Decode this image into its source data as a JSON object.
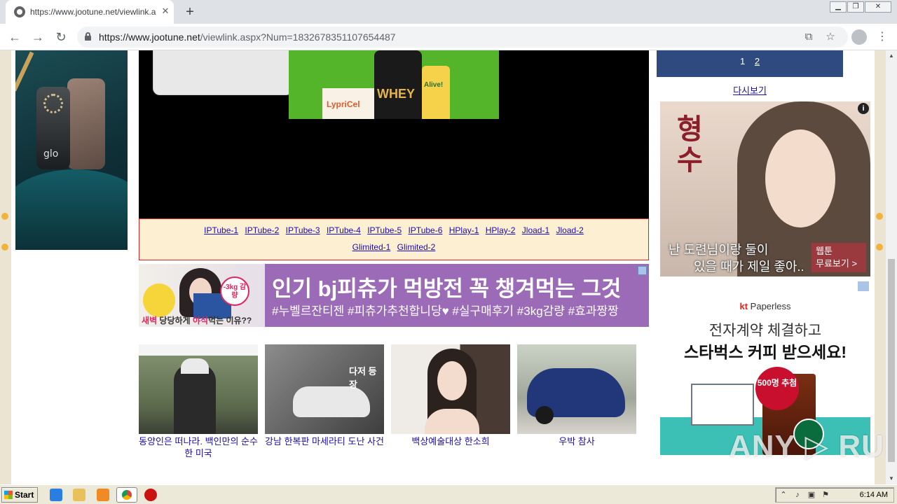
{
  "browser": {
    "tab_title": "https://www.jootune.net/viewlink.a",
    "url_host": "https://www.jootune.net",
    "url_path": "/viewlink.aspx?Num=1832678351107654487",
    "new_tab_symbol": "+",
    "close_symbol": "✕"
  },
  "left_ad": {
    "brand": "glo"
  },
  "player_banner": {
    "tub_label": "WHEY",
    "bottle_label": "Alive!",
    "box_label": "LypriCel"
  },
  "link_bar": {
    "row1": [
      "IPTube-1",
      "IPTube-2",
      "IPTube-3",
      "IPTube-4",
      "IPTube-5",
      "IPTube-6",
      "HPlay-1",
      "HPlay-2",
      "Jload-1",
      "Jload-2"
    ],
    "row2": [
      "Glimited-1",
      "Glimited-2"
    ]
  },
  "promo": {
    "headline": "인기 bj피츄가 먹방전 꼭 챙겨먹는 그것",
    "tags": "#누벨르잔티젠 #피츄가추천합니당♥ #실구매후기 #3kg감량 #효과짱짱",
    "badge": "-3kg 감량",
    "caption_red1": "새벽",
    "caption_mid": " 당당하게 ",
    "caption_red2": "야식",
    "caption_end": "먹는 이유??"
  },
  "thumbnails": [
    {
      "caption": "동양인은 떠나라. 백인만의 순수한 미국"
    },
    {
      "caption": "강남 한복판 마세라티 도난 사건",
      "overlay": "다저 등장"
    },
    {
      "caption": "백상예술대상 한소희"
    },
    {
      "caption": "우박 참사"
    }
  ],
  "pager": {
    "pages": [
      "1",
      "2"
    ]
  },
  "retry_label": "다시보기",
  "webtoon_ad": {
    "title": "형수",
    "line1": "난 도련님이랑 둘이",
    "line2": "있을 때가 제일 좋아..",
    "cta_line1": "웹툰",
    "cta_line2": "무료보기 >",
    "info": "i"
  },
  "kt_ad": {
    "brand_kt": "kt",
    "brand_name": " Paperless",
    "line1": "전자계약 체결하고",
    "line2": "스타벅스 커피 받으세요!",
    "seal": "500명 추첨"
  },
  "watermark": "ANY ▷ RUN",
  "taskbar": {
    "start_label": "Start",
    "clock": "6:14 AM"
  }
}
